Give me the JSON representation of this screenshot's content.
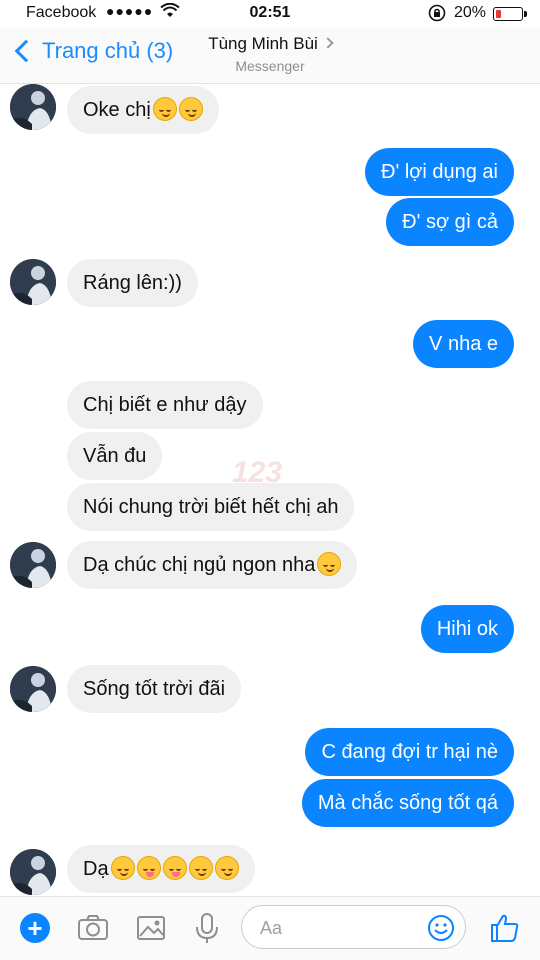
{
  "status_bar": {
    "carrier": "Facebook",
    "signal": "●●●●●",
    "time": "02:51",
    "battery_percent": "20%",
    "battery_level": 0.2
  },
  "nav": {
    "back_label": "Trang chủ (3)",
    "contact_name": "Tùng Minh Bùi",
    "contact_subtitle": "Messenger"
  },
  "messages": [
    {
      "from": "them",
      "text": "Oke chị",
      "emoji": [
        "relieved",
        "relieved"
      ]
    },
    {
      "from": "me",
      "text": "Đ' lợi dụng ai"
    },
    {
      "from": "me",
      "text": "Đ' sợ gì cả"
    },
    {
      "from": "them",
      "text": "Ráng lên:))"
    },
    {
      "from": "me",
      "text": "V nha e"
    },
    {
      "from": "them",
      "text": "Chị biết e như dậy"
    },
    {
      "from": "them",
      "text": "Vẫn đu"
    },
    {
      "from": "them",
      "text": "Nói chung trời biết hết chị ah"
    },
    {
      "from": "them",
      "text": "Dạ chúc chị ngủ ngon nha",
      "emoji": [
        "relieved"
      ]
    },
    {
      "from": "me",
      "text": "Hihi ok"
    },
    {
      "from": "them",
      "text": "Sống tốt trời đãi"
    },
    {
      "from": "me",
      "text": "C đang đợi tr hại nè"
    },
    {
      "from": "me",
      "text": "Mà chắc sống tốt qá"
    },
    {
      "from": "them",
      "text": "Dạ",
      "emoji": [
        "relieved",
        "yum",
        "yum",
        "relieved",
        "relieved"
      ]
    }
  ],
  "composer": {
    "placeholder": "Aa"
  },
  "colors": {
    "accent": "#0a84ff",
    "incoming_bubble": "#f1f0f0",
    "battery_low": "#e53935"
  }
}
